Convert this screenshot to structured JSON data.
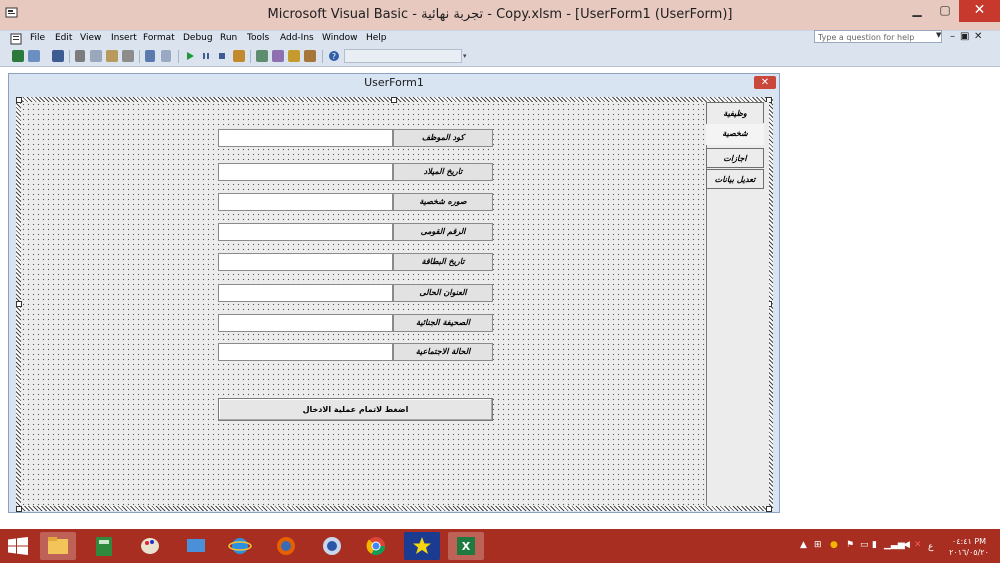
{
  "window": {
    "title": "Microsoft Visual Basic - تجربة نهائية - Copy.xlsm - [UserForm1 (UserForm)]"
  },
  "menu": [
    "File",
    "Edit",
    "View",
    "Insert",
    "Format",
    "Debug",
    "Run",
    "Tools",
    "Add-Ins",
    "Window",
    "Help"
  ],
  "help_box": {
    "placeholder": "Type a question for help"
  },
  "designer": {
    "title": "UserForm1"
  },
  "tabs": [
    "وظيفية",
    "شخصية",
    "اجازات",
    "تعديل بيانات"
  ],
  "fields": [
    {
      "label": "كود الموظف",
      "value": ""
    },
    {
      "label": "تاريخ الميلاد",
      "value": ""
    },
    {
      "label": "صوره شخصية",
      "value": ""
    },
    {
      "label": "الرقم القومى",
      "value": ""
    },
    {
      "label": "تاريخ البطاقة",
      "value": ""
    },
    {
      "label": "العنوان الحالى",
      "value": ""
    },
    {
      "label": "الصحيفة الجنائية",
      "value": ""
    },
    {
      "label": "الحالة الاجتماعية",
      "value": ""
    }
  ],
  "submit_button": {
    "label": "اضغط لاتمام عملية الادخال"
  },
  "taskbar": {
    "language": "ع",
    "time": "٠٤:٤١ PM",
    "date": "٢٠١٦/٠٥/٢٠",
    "apps": [
      "file-explorer",
      "calculator",
      "paint",
      "remote-desktop",
      "internet-explorer",
      "firefox",
      "browser-globe",
      "chrome",
      "media-player",
      "excel"
    ]
  },
  "colors": {
    "title_bar": "#e8c9c0",
    "menu_bar": "#dbe3ef",
    "taskbar": "#a82e21",
    "close": "#c7382d"
  }
}
